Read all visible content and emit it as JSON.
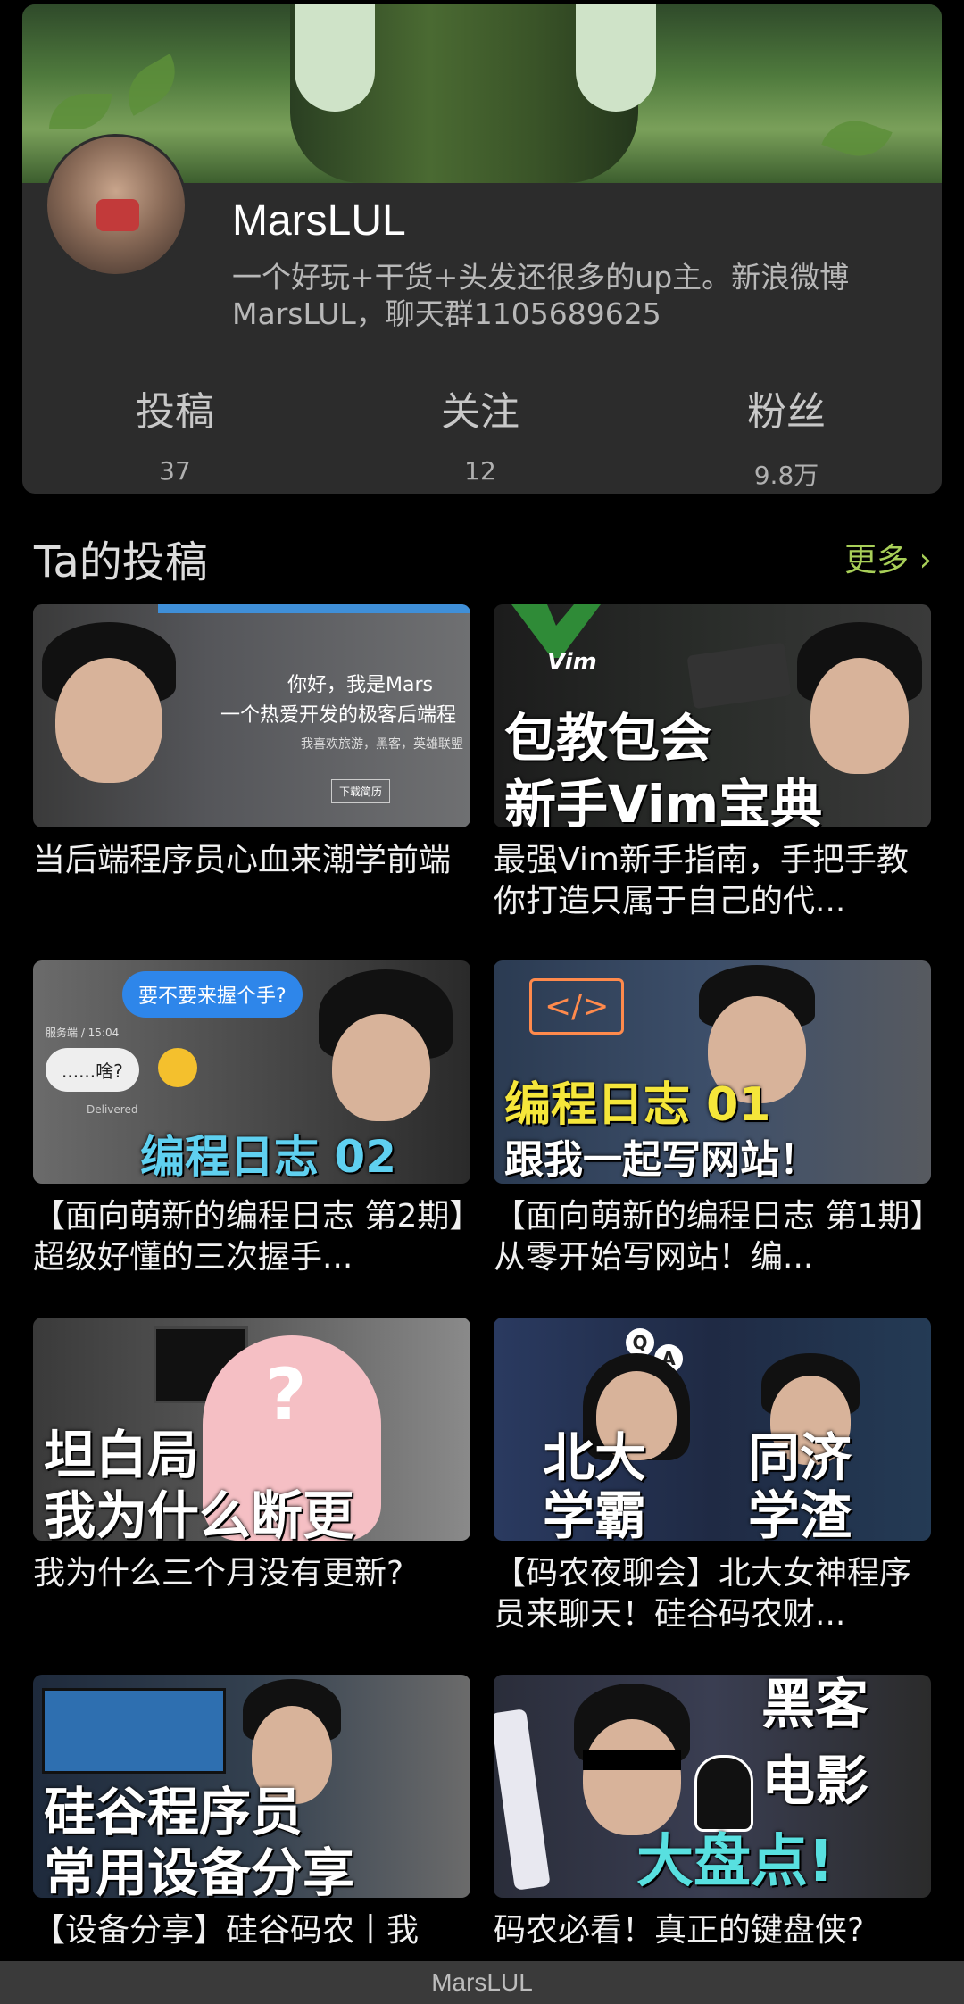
{
  "profile": {
    "username": "MarsLUL",
    "bio": "一个好玩+干货+头发还很多的up主。新浪微博MarsLUL，聊天群1105689625",
    "stats": [
      {
        "label": "投稿",
        "value": "37"
      },
      {
        "label": "关注",
        "value": "12"
      },
      {
        "label": "粉丝",
        "value": "9.8万"
      }
    ]
  },
  "section": {
    "title": "Ta的投稿",
    "more_label": "更多 ›"
  },
  "videos": [
    {
      "title": "当后端程序员心血来潮学前端",
      "thumb_text": [
        "你好，我是Mars",
        "一个热爱开发的极客后端程",
        "我喜欢旅游，黑客，英雄联盟",
        "下载简历"
      ]
    },
    {
      "title": "最强Vim新手指南，手把手教你打造只属于自己的代...",
      "thumb_text": [
        "Vim",
        "包教包会",
        "新手Vim宝典"
      ]
    },
    {
      "title": "【面向萌新的编程日志 第2期】超级好懂的三次握手...",
      "thumb_text": [
        "要不要来握个手?",
        "......啥?",
        "服务端 / 15:04",
        "Delivered",
        "编程日志 02"
      ]
    },
    {
      "title": "【面向萌新的编程日志 第1期】从零开始写网站！编...",
      "thumb_text": [
        "</>",
        "编程日志 01",
        "跟我一起写网站！"
      ]
    },
    {
      "title": "我为什么三个月没有更新?",
      "thumb_text": [
        "?",
        "坦白局",
        "我为什么断更"
      ]
    },
    {
      "title": "【码农夜聊会】北大女神程序员来聊天！硅谷码农财...",
      "thumb_text": [
        "Q",
        "A",
        "北大",
        "学霸",
        "同济",
        "学渣"
      ]
    },
    {
      "title": "【设备分享】硅谷码农丨我",
      "thumb_text": [
        "硅谷程序员",
        "常用设备分享"
      ]
    },
    {
      "title": "码农必看！真正的键盘侠?",
      "thumb_text": [
        "黑客",
        "电影",
        "大盘点!"
      ]
    }
  ],
  "bottom_bar": {
    "label": "MarsLUL"
  },
  "colors": {
    "accent": "#a8cf58",
    "background": "#000000",
    "card": "#2c2c2c"
  }
}
